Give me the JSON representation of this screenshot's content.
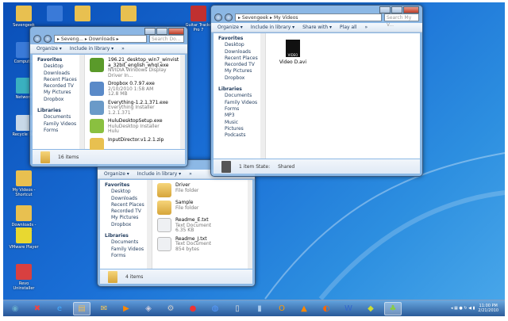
{
  "desktop": {
    "icons": [
      {
        "label": "Sevengeek",
        "color": "#e8c050"
      },
      {
        "label": "Computer",
        "color": "#3a7ad8"
      },
      {
        "label": "Network",
        "color": "#3ab0c0"
      },
      {
        "label": "Recycle Bin",
        "color": "#c8d8e8"
      },
      {
        "label": "My Videos - Shortcut",
        "color": "#e8c050"
      },
      {
        "label": "Downloads - Shortcut",
        "color": "#e8c050"
      },
      {
        "label": "VMware Player",
        "color": "#e8d830"
      },
      {
        "label": "Revo Uninstaller",
        "color": "#d84040"
      },
      {
        "label": "Guitar Tracks Pro 7",
        "color": "#c03030"
      }
    ]
  },
  "downloads_window": {
    "address": "▸ Seveng... ▸ Downloads ▸",
    "search": "Search Do...",
    "toolbar": [
      "Organize ▾",
      "Include in library ▾",
      "»"
    ],
    "nav": {
      "favorites": "Favorites",
      "fav_items": [
        "Desktop",
        "Downloads",
        "Recent Places",
        "Recorded TV",
        "My Pictures",
        "Dropbox"
      ],
      "libraries": "Libraries",
      "lib_items": [
        "Documents",
        "Family Videos",
        "Forms"
      ]
    },
    "files": [
      {
        "name": "196.21_desktop_win7_winvista_32bit_english_whql.exe",
        "sub": "NVIDIA Windows Display Driver In...",
        "sub2": "",
        "color": "#5a9a2a"
      },
      {
        "name": "Dropbox 0.7.97.exe",
        "sub": "2/10/2010 1:58 AM",
        "sub2": "12.8 MB",
        "color": "#5a8ac8"
      },
      {
        "name": "Everything-1.2.1.371.exe",
        "sub": "Everything Installer",
        "sub2": "1.2.1.371",
        "color": "#6a9ac8"
      },
      {
        "name": "HuluDesktopSetup.exe",
        "sub": "HuluDesktop Installer",
        "sub2": "Hulu",
        "color": "#8ac040"
      },
      {
        "name": "InputDirector.v1.2.1.zip",
        "sub": "",
        "sub2": "",
        "color": "#e8c050"
      }
    ],
    "status": "16 items"
  },
  "videos_window": {
    "address": "▸ Sevengeek ▸ My Videos",
    "search": "Search My V...",
    "toolbar": [
      "Organize ▾",
      "Include in library ▾",
      "Share with ▾",
      "Play all",
      "»"
    ],
    "nav": {
      "favorites": "Favorites",
      "fav_items": [
        "Desktop",
        "Downloads",
        "Recent Places",
        "Recorded TV",
        "My Pictures",
        "Dropbox"
      ],
      "libraries": "Libraries",
      "lib_items": [
        "Documents",
        "Family Videos",
        "Forms",
        "MP3",
        "Music",
        "Pictures",
        "Podcasts"
      ]
    },
    "files": [
      {
        "name": "Video D.avi",
        "badge": "VIDEO"
      }
    ],
    "status": "1 item  State:",
    "shared": "Shared"
  },
  "third_window": {
    "toolbar": [
      "Organize ▾",
      "Include in library ▾",
      "»"
    ],
    "nav": {
      "favorites": "Favorites",
      "fav_items": [
        "Desktop",
        "Downloads",
        "Recent Places",
        "Recorded TV",
        "My Pictures",
        "Dropbox"
      ],
      "libraries": "Libraries",
      "lib_items": [
        "Documents",
        "Family Videos",
        "Forms"
      ]
    },
    "files": [
      {
        "name": "Driver",
        "sub": "File folder",
        "sub2": "",
        "type": "folder"
      },
      {
        "name": "Sample",
        "sub": "File folder",
        "sub2": "",
        "type": "folder"
      },
      {
        "name": "Readme_E.txt",
        "sub": "Text Document",
        "sub2": "6.35 KB",
        "type": "doc"
      },
      {
        "name": "Readme_J.txt",
        "sub": "Text Document",
        "sub2": "854 bytes",
        "type": "doc"
      }
    ],
    "status": "4 items"
  },
  "taskbar": {
    "items": [
      {
        "name": "start",
        "glyph": "◉",
        "color": "#6ac"
      },
      {
        "name": "app-x",
        "glyph": "✖",
        "color": "#e44"
      },
      {
        "name": "ie",
        "glyph": "e",
        "color": "#4af"
      },
      {
        "name": "explorer",
        "glyph": "▤",
        "color": "#eb5",
        "active": true
      },
      {
        "name": "mail",
        "glyph": "✉",
        "color": "#fc5"
      },
      {
        "name": "media",
        "glyph": "▶",
        "color": "#f80"
      },
      {
        "name": "virtualbox",
        "glyph": "◈",
        "color": "#ccd"
      },
      {
        "name": "settings",
        "glyph": "⚙",
        "color": "#ccc"
      },
      {
        "name": "chrome",
        "glyph": "●",
        "color": "#e33"
      },
      {
        "name": "app-blue",
        "glyph": "◍",
        "color": "#59f"
      },
      {
        "name": "doc",
        "glyph": "▯",
        "color": "#ddd"
      },
      {
        "name": "notes",
        "glyph": "▮",
        "color": "#ace"
      },
      {
        "name": "outlook",
        "glyph": "O",
        "color": "#f90"
      },
      {
        "name": "vlc",
        "glyph": "▲",
        "color": "#f80"
      },
      {
        "name": "firefox",
        "glyph": "◐",
        "color": "#f60"
      },
      {
        "name": "word",
        "glyph": "W",
        "color": "#36c"
      },
      {
        "name": "app-green",
        "glyph": "◆",
        "color": "#cd3"
      },
      {
        "name": "app-active",
        "glyph": "♣",
        "color": "#8c4",
        "active": true
      }
    ],
    "clock_time": "11:00 PM",
    "clock_date": "2/21/2010"
  }
}
